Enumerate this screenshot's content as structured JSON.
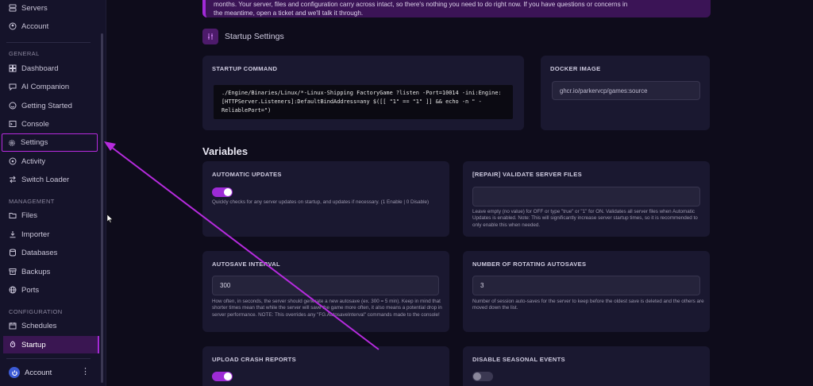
{
  "sidebar": {
    "top_items": [
      {
        "label": "Servers",
        "icon": "server-icon"
      },
      {
        "label": "Account",
        "icon": "account-circle-icon"
      }
    ],
    "sections": {
      "general": "GENERAL",
      "management": "MANAGEMENT",
      "configuration": "CONFIGURATION"
    },
    "general_items": [
      {
        "label": "Dashboard",
        "icon": "dashboard-icon"
      },
      {
        "label": "AI Companion",
        "icon": "chat-icon"
      },
      {
        "label": "Getting Started",
        "icon": "smile-icon"
      },
      {
        "label": "Console",
        "icon": "terminal-icon"
      },
      {
        "label": "Settings",
        "icon": "gear-icon"
      },
      {
        "label": "Activity",
        "icon": "activity-icon"
      },
      {
        "label": "Switch Loader",
        "icon": "switch-icon"
      }
    ],
    "management_items": [
      {
        "label": "Files",
        "icon": "folder-icon"
      },
      {
        "label": "Importer",
        "icon": "download-icon"
      },
      {
        "label": "Databases",
        "icon": "database-icon"
      },
      {
        "label": "Backups",
        "icon": "archive-icon"
      },
      {
        "label": "Ports",
        "icon": "globe-icon"
      }
    ],
    "configuration_items": [
      {
        "label": "Schedules",
        "icon": "calendar-icon"
      },
      {
        "label": "Startup",
        "icon": "rocket-icon"
      }
    ],
    "account_label": "Account"
  },
  "notice": {
    "line1": "months. Your server, files and configuration carry across intact, so there's nothing you need to do right now. If you have questions or concerns in",
    "line2": "the meantime, open a ticket and we'll talk it through."
  },
  "startup": {
    "heading": "Startup Settings",
    "command_title": "STARTUP COMMAND",
    "command": "./Engine/Binaries/Linux/*-Linux-Shipping FactoryGame ?listen -Port=10014 -ini:Engine:[HTTPServer.Listeners]:DefaultBindAddress=any $([[ \"1\" == \"1\" ]] && echo -n \" -ReliablePort=\")",
    "docker_title": "DOCKER IMAGE",
    "docker_image": "ghcr.io/parkervcp/games:source"
  },
  "variables": {
    "title": "Variables",
    "items": [
      {
        "title": "AUTOMATIC UPDATES",
        "type": "toggle",
        "enabled": true,
        "description": "Quickly checks for any server updates on startup, and updates if necessary. (1 Enable | 0 Disable)"
      },
      {
        "title": "[REPAIR] VALIDATE SERVER FILES",
        "type": "input",
        "value": "",
        "description": "Leave empty (no value) for OFF or type \"true\" or \"1\" for ON. Validates all server files when Automatic Updates is enabled. Note: This will significantly increase server startup times, so it is recommended to only enable this when needed."
      },
      {
        "title": "AUTOSAVE INTERVAL",
        "type": "input",
        "value": "300",
        "description": "How often, in seconds, the server should generate a new autosave (ex. 300 = 5 min). Keep in mind that shorter times mean that while the server will save the game more often, it also means a potential drop in server performance. NOTE: This overrides any \"FG.AutosaveInterval\" commands made to the console!"
      },
      {
        "title": "NUMBER OF ROTATING AUTOSAVES",
        "type": "input",
        "value": "3",
        "description": "Number of session auto-saves for the server to keep before the oldest save is deleted and the others are moved down the list."
      },
      {
        "title": "UPLOAD CRASH REPORTS",
        "type": "toggle",
        "enabled": true,
        "description": ""
      },
      {
        "title": "DISABLE SEASONAL EVENTS",
        "type": "toggle",
        "enabled": false,
        "description": ""
      }
    ]
  },
  "colors": {
    "accent": "#a12ad8",
    "background": "#0e0c1b",
    "card": "#1a1830",
    "annotation": "#b62bde"
  }
}
